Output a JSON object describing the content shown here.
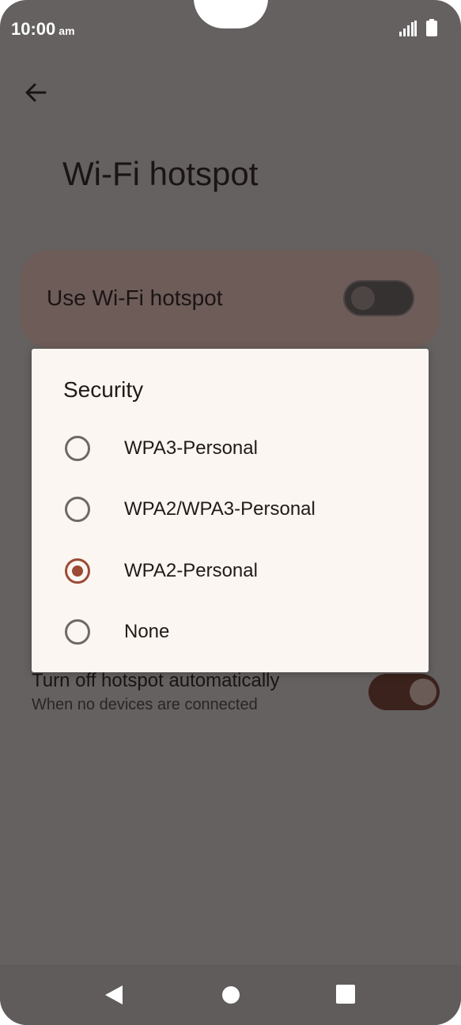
{
  "status_bar": {
    "time": "10:00",
    "ampm": "am",
    "icons": [
      "signal-icon",
      "battery-icon"
    ]
  },
  "header": {
    "back_icon": "arrow-left-icon",
    "title": "Wi-Fi hotspot"
  },
  "main_switch": {
    "label": "Use Wi-Fi hotspot",
    "state": "off"
  },
  "auto_off": {
    "title": "Turn off hotspot automatically",
    "subtitle": "When no devices are connected",
    "state": "on"
  },
  "dialog": {
    "title": "Security",
    "options": [
      {
        "label": "WPA3-Personal",
        "selected": false
      },
      {
        "label": "WPA2/WPA3-Personal",
        "selected": false
      },
      {
        "label": "WPA2-Personal",
        "selected": true
      },
      {
        "label": "None",
        "selected": false
      }
    ]
  },
  "nav_bar": {
    "icons": [
      "back-triangle-icon",
      "home-circle-icon",
      "recents-square-icon"
    ]
  },
  "colors": {
    "scrim": "#646160",
    "dialog_bg": "#fcf6f2",
    "accent": "#9b4a35"
  }
}
